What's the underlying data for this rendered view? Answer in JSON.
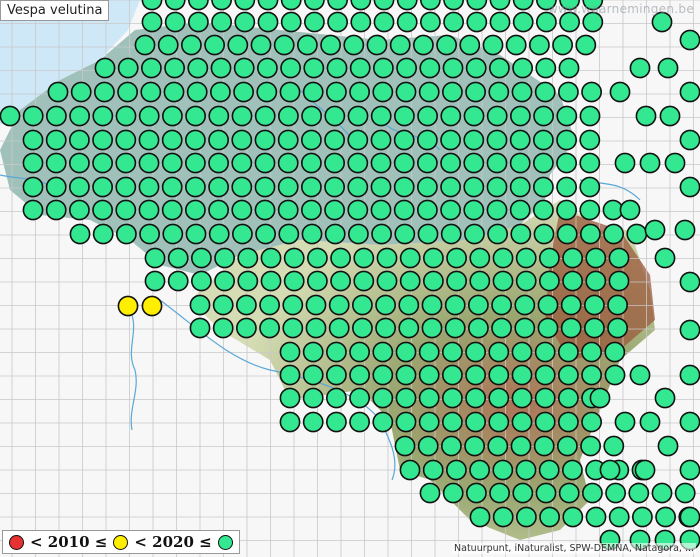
{
  "title": "Vespa velutina",
  "watermark": "www.waarnemingen.be",
  "legend": {
    "items": [
      {
        "name": "red",
        "color": "#e63232",
        "label": "< 2010 ≤"
      },
      {
        "name": "yellow",
        "color": "#ffee00",
        "label": "< 2020 ≤"
      },
      {
        "name": "green",
        "color": "#33e890",
        "label": ""
      }
    ]
  },
  "credits": "Natuurpunt, iNaturalist, SPW-DEMNA, Natagora, ...",
  "colors": {
    "sea": "#cfe8f7",
    "land": "#f7f7f7",
    "flanders": "#8fb7ae",
    "grid": "#c8c8c8",
    "dot_green": "#33e890",
    "dot_yellow": "#ffee00",
    "dot_border": "#111111"
  },
  "map_data": {
    "species": "Vespa velutina",
    "time_classes": [
      "< 2010",
      "2010–2020",
      "≥ 2020"
    ],
    "yellow_cell_count": 2
  }
}
